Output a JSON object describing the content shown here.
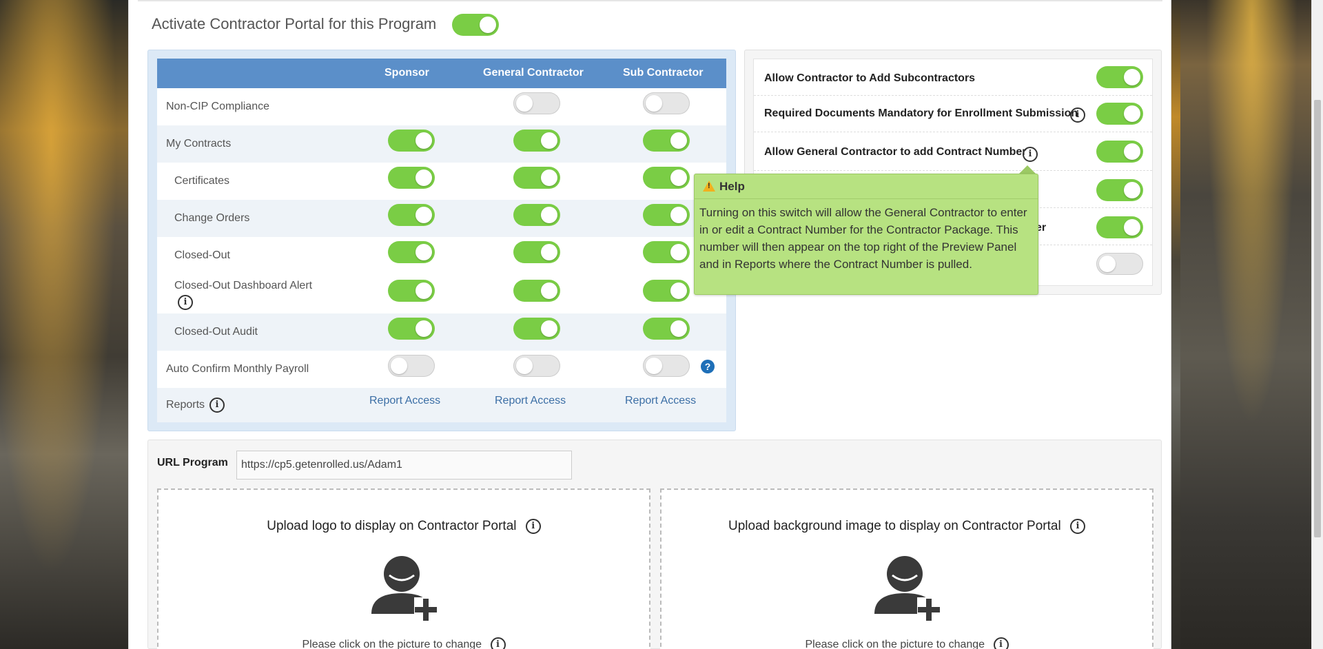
{
  "portal": {
    "title": "Activate Contractor Portal for this Program",
    "active": true
  },
  "permissions": {
    "columns": [
      "Sponsor",
      "General Contractor",
      "Sub Contractor"
    ],
    "rows": [
      {
        "label": "Non-CIP Compliance",
        "sponsor": null,
        "general": false,
        "sub": false
      },
      {
        "label": "My Contracts",
        "sponsor": true,
        "general": true,
        "sub": true
      },
      {
        "label": "Certificates",
        "sponsor": true,
        "general": true,
        "sub": true
      },
      {
        "label": "Change Orders",
        "sponsor": true,
        "general": true,
        "sub": true
      },
      {
        "label": "Closed-Out",
        "sponsor": true,
        "general": true,
        "sub": true
      },
      {
        "label": "Closed-Out Dashboard Alert",
        "sponsor": true,
        "general": true,
        "sub": true,
        "info_icon": "info-icon"
      },
      {
        "label": "Closed-Out Audit",
        "sponsor": true,
        "general": true,
        "sub": true
      },
      {
        "label": "Auto Confirm Monthly Payroll",
        "sponsor": false,
        "general": false,
        "sub": false,
        "help_icon": "?"
      },
      {
        "label": "Reports",
        "info_icon": "info-icon",
        "links": [
          "Report Access",
          "Report Access",
          "Report Access"
        ]
      }
    ]
  },
  "options": [
    {
      "label": "Allow Contractor to Add Subcontractors",
      "on": true
    },
    {
      "label": "Required Documents Mandatory for Enrollment Submission",
      "on": true,
      "info_icon": "info-icon"
    },
    {
      "label": "Allow General Contractor to add Contract Number",
      "on": true,
      "info_icon": "info-icon"
    },
    {
      "label": "",
      "on": true
    },
    {
      "label": "er",
      "on": true
    },
    {
      "label": "",
      "on": false
    }
  ],
  "tooltip": {
    "title": "Help",
    "icon": "warning-icon",
    "body": "Turning on this switch will allow the General Contractor to enter in or edit a Contract Number for the Contractor Package. This number will then appear on the top right of the Preview Panel and in Reports where the Contract Number is pulled."
  },
  "url_program": {
    "label": "URL Program",
    "value": "https://cp5.getenrolled.us/Adam1"
  },
  "uploads": [
    {
      "title": "Upload logo to display on Contractor Portal",
      "subtitle": "Please click on the picture to change"
    },
    {
      "title": "Upload background image to display on Contractor Portal",
      "subtitle": "Please click on the picture to change"
    }
  ],
  "colors": {
    "toggle_on": "#7acd45",
    "header_blue": "#5b8fc9",
    "tooltip_green": "#b7e281",
    "link_blue": "#3b6ea5"
  }
}
